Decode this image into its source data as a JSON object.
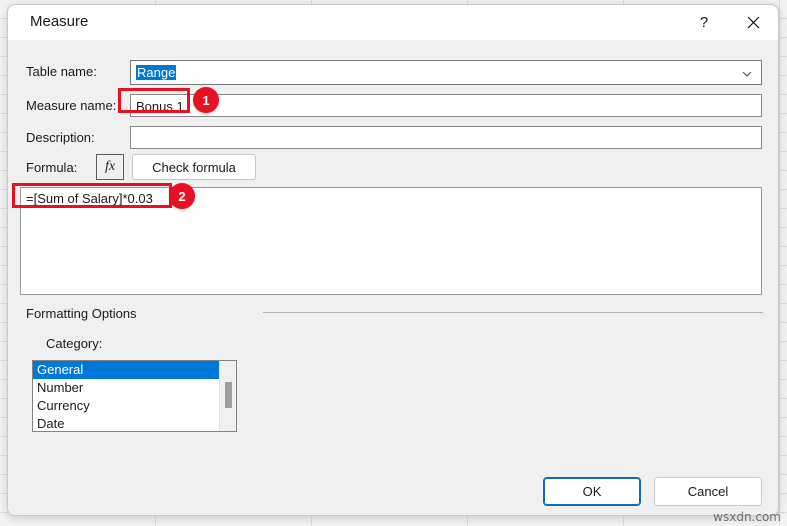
{
  "background": {
    "name": "excel-worksheet-grid"
  },
  "dialog": {
    "title": "Measure",
    "titlebar": {
      "help_label": "?",
      "close_icon": "close-icon"
    },
    "fields": {
      "table_name_label": "Table name:",
      "table_name_value": "Range",
      "table_name_chevron": "chevron-down-icon",
      "measure_name_label": "Measure name:",
      "measure_name_value": "Bonus 1",
      "description_label": "Description:",
      "description_value": "",
      "formula_label": "Formula:",
      "fx_button_label": "fx",
      "check_formula_label": "Check formula",
      "formula_value": "=[Sum of Salary]*0.03"
    },
    "formatting": {
      "group_label": "Formatting Options",
      "category_label": "Category:",
      "categories": [
        {
          "label": "General",
          "selected": true
        },
        {
          "label": "Number",
          "selected": false
        },
        {
          "label": "Currency",
          "selected": false
        },
        {
          "label": "Date",
          "selected": false
        }
      ]
    },
    "buttons": {
      "ok_label": "OK",
      "cancel_label": "Cancel"
    }
  },
  "annotations": {
    "badge_1": "1",
    "badge_2": "2",
    "color": "#e81123"
  },
  "watermark": "wsxdn.com"
}
